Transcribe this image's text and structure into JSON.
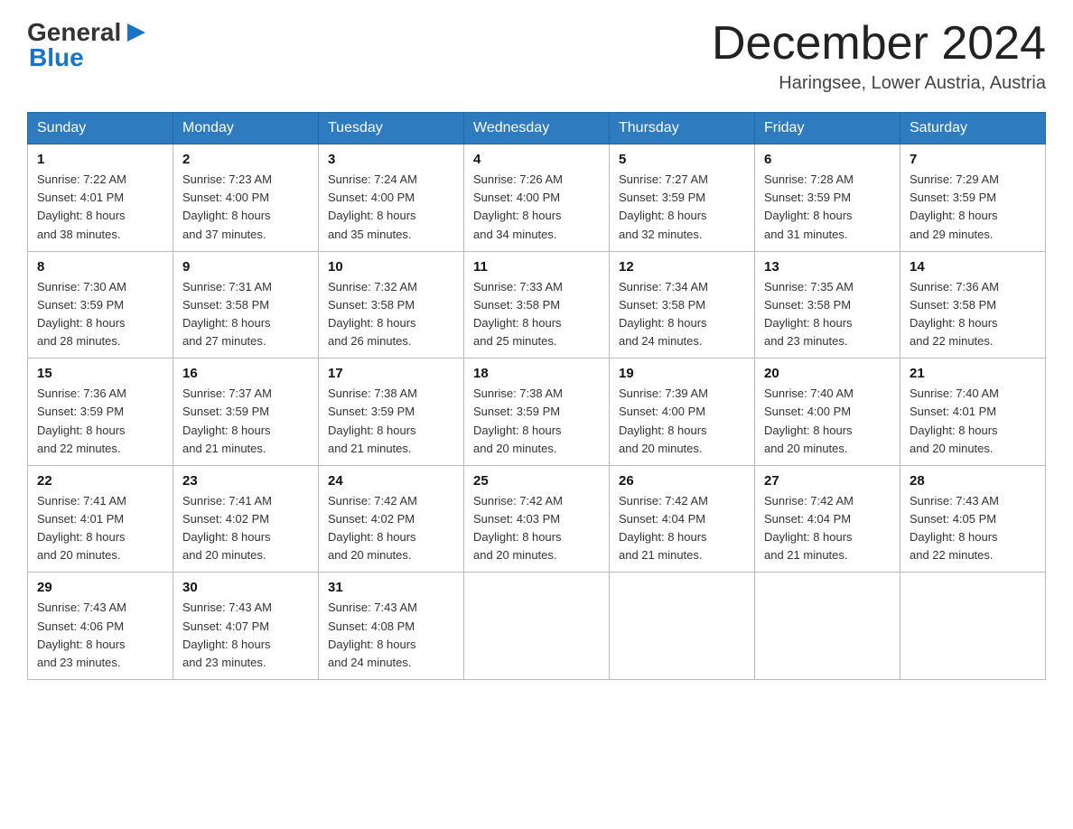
{
  "header": {
    "logo": {
      "general": "General",
      "blue": "Blue"
    },
    "title": "December 2024",
    "location": "Haringsee, Lower Austria, Austria"
  },
  "calendar": {
    "days_of_week": [
      "Sunday",
      "Monday",
      "Tuesday",
      "Wednesday",
      "Thursday",
      "Friday",
      "Saturday"
    ],
    "weeks": [
      [
        {
          "day": "1",
          "sunrise": "7:22 AM",
          "sunset": "4:01 PM",
          "daylight": "8 hours and 38 minutes."
        },
        {
          "day": "2",
          "sunrise": "7:23 AM",
          "sunset": "4:00 PM",
          "daylight": "8 hours and 37 minutes."
        },
        {
          "day": "3",
          "sunrise": "7:24 AM",
          "sunset": "4:00 PM",
          "daylight": "8 hours and 35 minutes."
        },
        {
          "day": "4",
          "sunrise": "7:26 AM",
          "sunset": "4:00 PM",
          "daylight": "8 hours and 34 minutes."
        },
        {
          "day": "5",
          "sunrise": "7:27 AM",
          "sunset": "3:59 PM",
          "daylight": "8 hours and 32 minutes."
        },
        {
          "day": "6",
          "sunrise": "7:28 AM",
          "sunset": "3:59 PM",
          "daylight": "8 hours and 31 minutes."
        },
        {
          "day": "7",
          "sunrise": "7:29 AM",
          "sunset": "3:59 PM",
          "daylight": "8 hours and 29 minutes."
        }
      ],
      [
        {
          "day": "8",
          "sunrise": "7:30 AM",
          "sunset": "3:59 PM",
          "daylight": "8 hours and 28 minutes."
        },
        {
          "day": "9",
          "sunrise": "7:31 AM",
          "sunset": "3:58 PM",
          "daylight": "8 hours and 27 minutes."
        },
        {
          "day": "10",
          "sunrise": "7:32 AM",
          "sunset": "3:58 PM",
          "daylight": "8 hours and 26 minutes."
        },
        {
          "day": "11",
          "sunrise": "7:33 AM",
          "sunset": "3:58 PM",
          "daylight": "8 hours and 25 minutes."
        },
        {
          "day": "12",
          "sunrise": "7:34 AM",
          "sunset": "3:58 PM",
          "daylight": "8 hours and 24 minutes."
        },
        {
          "day": "13",
          "sunrise": "7:35 AM",
          "sunset": "3:58 PM",
          "daylight": "8 hours and 23 minutes."
        },
        {
          "day": "14",
          "sunrise": "7:36 AM",
          "sunset": "3:58 PM",
          "daylight": "8 hours and 22 minutes."
        }
      ],
      [
        {
          "day": "15",
          "sunrise": "7:36 AM",
          "sunset": "3:59 PM",
          "daylight": "8 hours and 22 minutes."
        },
        {
          "day": "16",
          "sunrise": "7:37 AM",
          "sunset": "3:59 PM",
          "daylight": "8 hours and 21 minutes."
        },
        {
          "day": "17",
          "sunrise": "7:38 AM",
          "sunset": "3:59 PM",
          "daylight": "8 hours and 21 minutes."
        },
        {
          "day": "18",
          "sunrise": "7:38 AM",
          "sunset": "3:59 PM",
          "daylight": "8 hours and 20 minutes."
        },
        {
          "day": "19",
          "sunrise": "7:39 AM",
          "sunset": "4:00 PM",
          "daylight": "8 hours and 20 minutes."
        },
        {
          "day": "20",
          "sunrise": "7:40 AM",
          "sunset": "4:00 PM",
          "daylight": "8 hours and 20 minutes."
        },
        {
          "day": "21",
          "sunrise": "7:40 AM",
          "sunset": "4:01 PM",
          "daylight": "8 hours and 20 minutes."
        }
      ],
      [
        {
          "day": "22",
          "sunrise": "7:41 AM",
          "sunset": "4:01 PM",
          "daylight": "8 hours and 20 minutes."
        },
        {
          "day": "23",
          "sunrise": "7:41 AM",
          "sunset": "4:02 PM",
          "daylight": "8 hours and 20 minutes."
        },
        {
          "day": "24",
          "sunrise": "7:42 AM",
          "sunset": "4:02 PM",
          "daylight": "8 hours and 20 minutes."
        },
        {
          "day": "25",
          "sunrise": "7:42 AM",
          "sunset": "4:03 PM",
          "daylight": "8 hours and 20 minutes."
        },
        {
          "day": "26",
          "sunrise": "7:42 AM",
          "sunset": "4:04 PM",
          "daylight": "8 hours and 21 minutes."
        },
        {
          "day": "27",
          "sunrise": "7:42 AM",
          "sunset": "4:04 PM",
          "daylight": "8 hours and 21 minutes."
        },
        {
          "day": "28",
          "sunrise": "7:43 AM",
          "sunset": "4:05 PM",
          "daylight": "8 hours and 22 minutes."
        }
      ],
      [
        {
          "day": "29",
          "sunrise": "7:43 AM",
          "sunset": "4:06 PM",
          "daylight": "8 hours and 23 minutes."
        },
        {
          "day": "30",
          "sunrise": "7:43 AM",
          "sunset": "4:07 PM",
          "daylight": "8 hours and 23 minutes."
        },
        {
          "day": "31",
          "sunrise": "7:43 AM",
          "sunset": "4:08 PM",
          "daylight": "8 hours and 24 minutes."
        },
        null,
        null,
        null,
        null
      ]
    ],
    "labels": {
      "sunrise": "Sunrise:",
      "sunset": "Sunset:",
      "daylight": "Daylight:"
    }
  }
}
